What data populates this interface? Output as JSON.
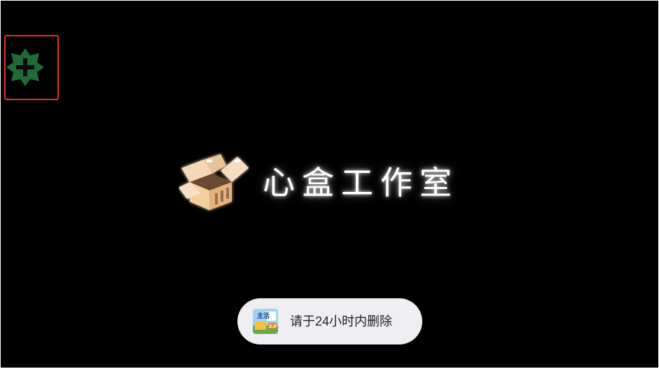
{
  "splash": {
    "studio_name": "心盒工作室",
    "logo_icon": "pixel-box-icon",
    "background_color": "#000000"
  },
  "add_button": {
    "icon": "plus-icon",
    "color": "#1e6b37",
    "highlight_color": "#e5322d"
  },
  "toast": {
    "message": "请于24小时内删除",
    "app_icon": "app-icon",
    "app_icon_text": "主活",
    "app_icon_sub": "2.0"
  }
}
